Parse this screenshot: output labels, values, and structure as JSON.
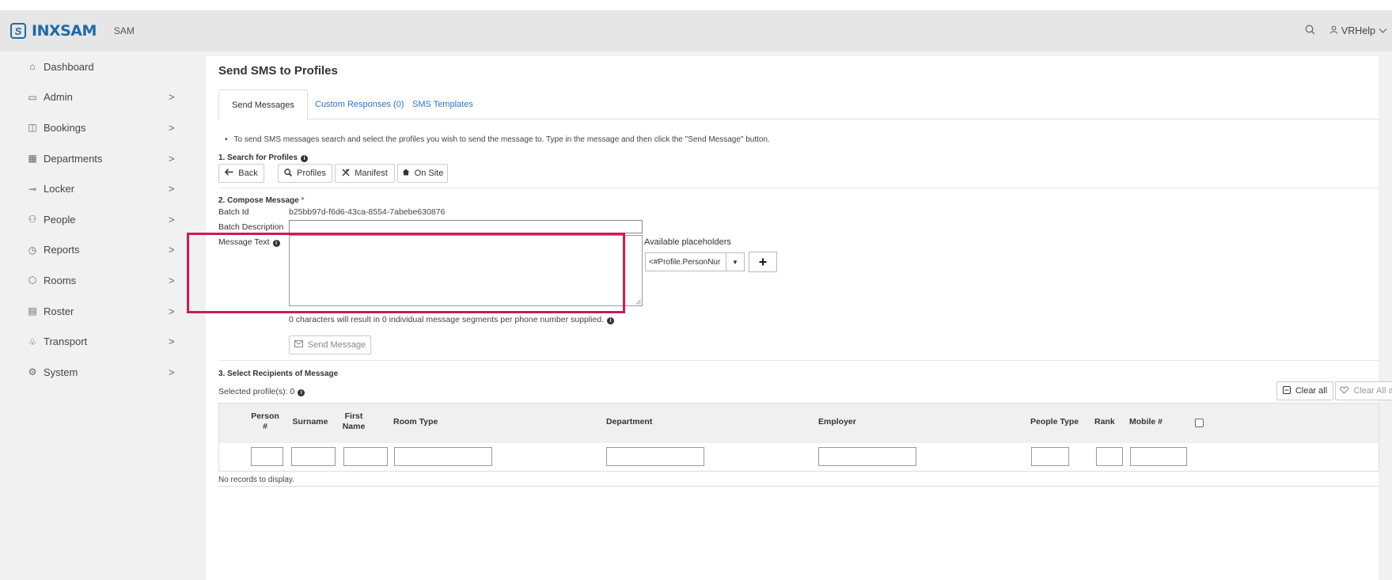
{
  "header": {
    "logo_glyph": "S",
    "logo_text": "INXSAM",
    "app_tag": "SAM",
    "user_name": "VRHelp"
  },
  "sidebar": {
    "items": [
      {
        "label": "Dashboard",
        "icon": "home-icon",
        "glyph": "⌂"
      },
      {
        "label": "Admin",
        "icon": "folder-icon",
        "glyph": "▭",
        "chevron": ">"
      },
      {
        "label": "Bookings",
        "icon": "book-icon",
        "glyph": "◫",
        "chevron": ">"
      },
      {
        "label": "Departments",
        "icon": "building-icon",
        "glyph": "▦",
        "chevron": ">"
      },
      {
        "label": "Locker",
        "icon": "key-icon",
        "glyph": "⊸",
        "chevron": ">"
      },
      {
        "label": "People",
        "icon": "people-icon",
        "glyph": "⚇",
        "chevron": ">"
      },
      {
        "label": "Reports",
        "icon": "clock-icon",
        "glyph": "◷",
        "chevron": ">"
      },
      {
        "label": "Rooms",
        "icon": "rooms-icon",
        "glyph": "⬡",
        "chevron": ">"
      },
      {
        "label": "Roster",
        "icon": "clipboard-icon",
        "glyph": "▤",
        "chevron": ">"
      },
      {
        "label": "Transport",
        "icon": "transport-icon",
        "glyph": "♧",
        "chevron": ">"
      },
      {
        "label": "System",
        "icon": "gear-icon",
        "glyph": "⚙",
        "chevron": ">"
      }
    ]
  },
  "page": {
    "title": "Send SMS to Profiles",
    "tabs": [
      "Send Messages",
      "Custom Responses (0)",
      "SMS Templates"
    ],
    "intro": "To send SMS messages search and select the profiles you wish to send the message to. Type in the message and then click the \"Send Message\" button."
  },
  "search": {
    "label": "1. Search for Profiles",
    "back": "Back",
    "profiles": "Profiles",
    "manifest": "Manifest",
    "on_site": "On Site"
  },
  "compose": {
    "label": "2. Compose Message",
    "required_mark": "*",
    "batch_id_label": "Batch Id",
    "batch_id_value": "b25bb97d-f6d6-43ca-8554-7abebe630876",
    "batch_desc_label": "Batch Description",
    "batch_desc_value": "",
    "message_text_label": "Message Text",
    "message_text_value": "",
    "placeholders_label": "Available placeholders",
    "placeholder_selected": "<#Profile.PersonNur",
    "segments_note": "0 characters will result in 0 individual message segments per phone number supplied.",
    "send_button": "Send Message"
  },
  "recipients": {
    "label": "3. Select Recipients of Message",
    "selected": "Selected profile(s): 0",
    "clear_all": "Clear all",
    "clear_all_monitor": "Clear All and Monitor",
    "columns": [
      "Person #",
      "Surname",
      "First Name",
      "Room Type",
      "Department",
      "Employer",
      "People Type",
      "Rank",
      "Mobile #"
    ],
    "empty": "No records to display."
  }
}
